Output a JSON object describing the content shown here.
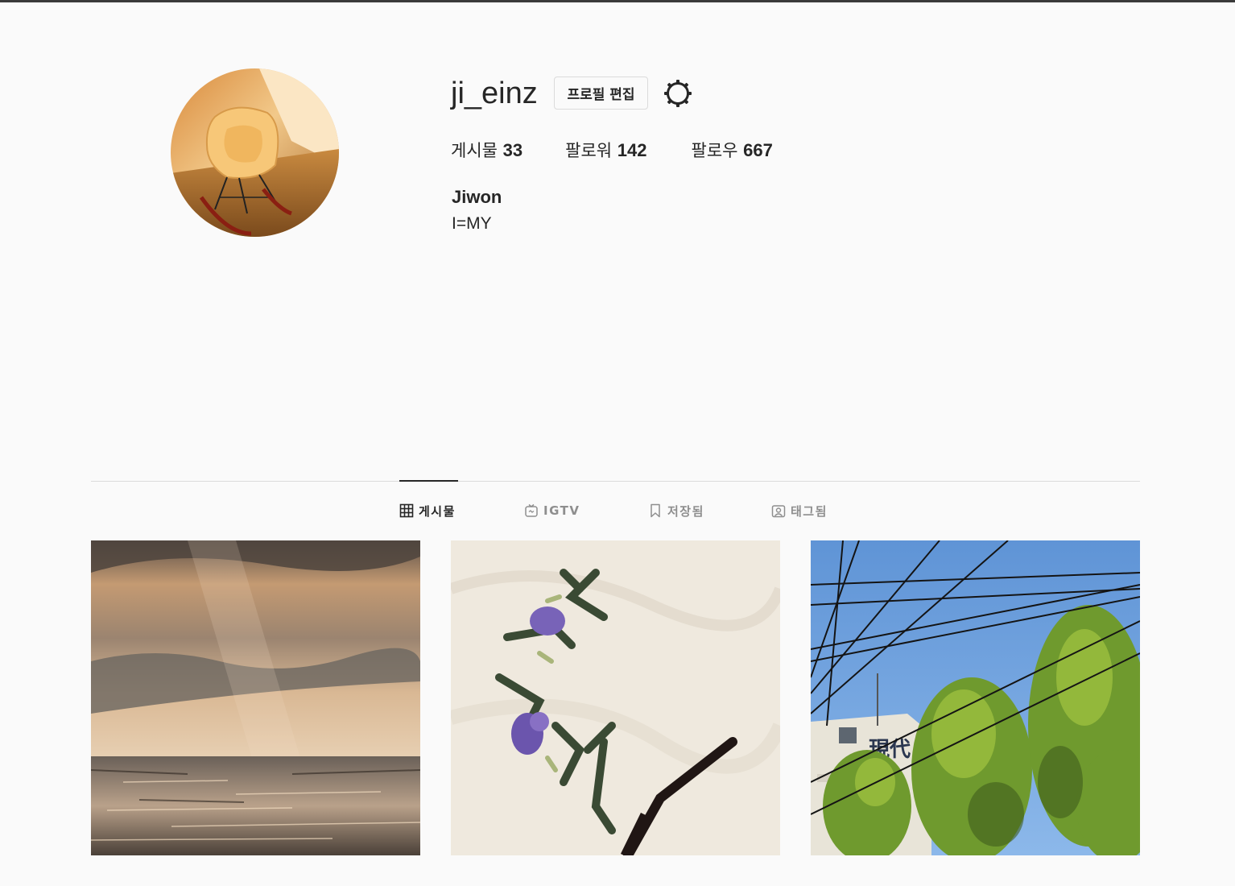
{
  "profile": {
    "username": "ji_einz",
    "edit_button": "프로필 편집",
    "stats": {
      "posts_label": "게시물",
      "posts_count": "33",
      "followers_label": "팔로워",
      "followers_count": "142",
      "following_label": "팔로우",
      "following_count": "667"
    },
    "full_name": "Jiwon",
    "bio": "I=MY"
  },
  "tabs": [
    {
      "label": "게시물",
      "icon": "grid-icon",
      "active": true
    },
    {
      "label": "IGTV",
      "icon": "igtv-icon",
      "active": false
    },
    {
      "label": "저장됨",
      "icon": "bookmark-icon",
      "active": false
    },
    {
      "label": "태그됨",
      "icon": "tagged-icon",
      "active": false
    }
  ],
  "posts": [
    {
      "subject": "sea-sunset-photo"
    },
    {
      "subject": "floral-knit-sweater-photo"
    },
    {
      "subject": "power-lines-trees-building-photo",
      "sign_text": "現代"
    }
  ],
  "colors": {
    "text": "#262626",
    "muted": "#8e8e8e",
    "border": "#dbdbdb",
    "background": "#fafafa"
  }
}
